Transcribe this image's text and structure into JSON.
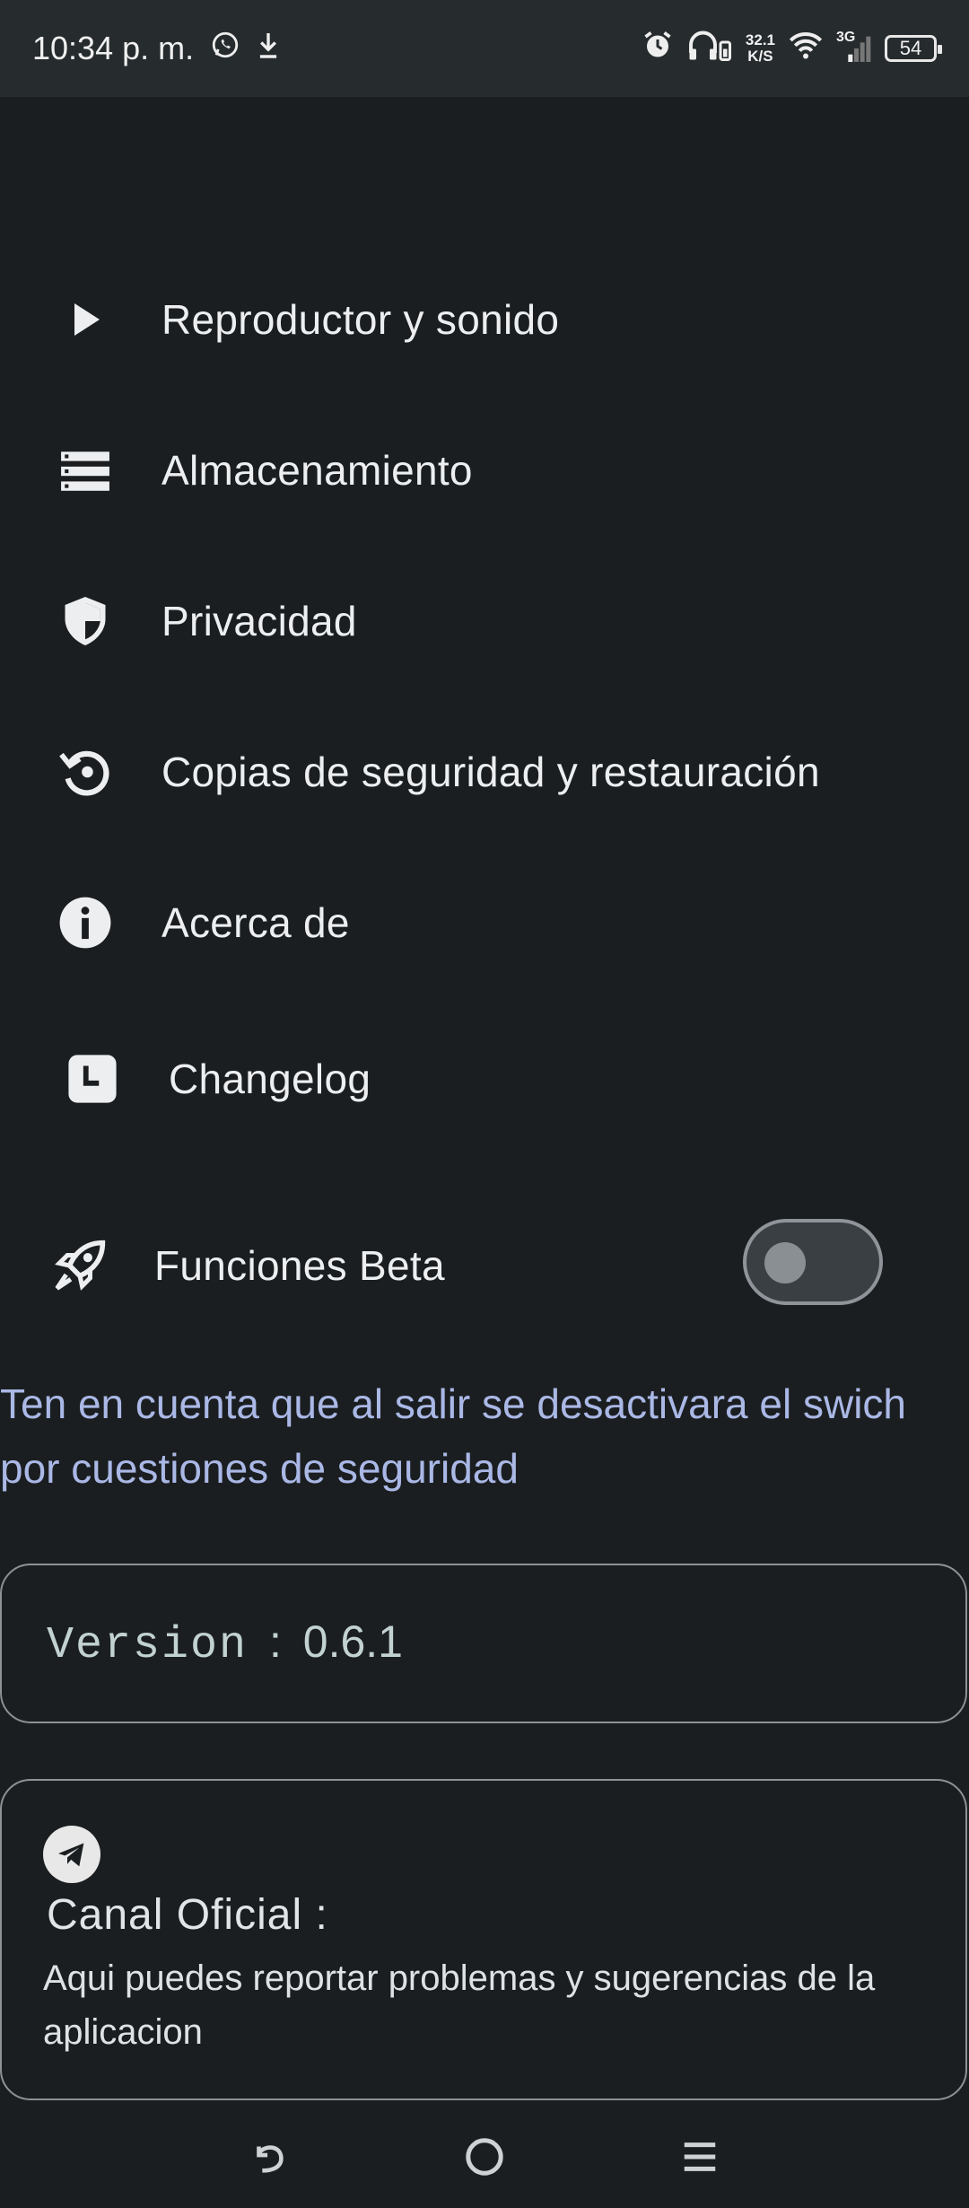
{
  "status_bar": {
    "time": "10:34 p. m.",
    "net_speed_value": "32.1",
    "net_speed_unit": "K/S",
    "network_type": "3G",
    "battery": "54"
  },
  "menu": {
    "items": [
      {
        "label": "Reproductor y sonido",
        "icon": "play-icon"
      },
      {
        "label": "Almacenamiento",
        "icon": "storage-icon"
      },
      {
        "label": "Privacidad",
        "icon": "shield-icon"
      },
      {
        "label": "Copias de seguridad y restauración",
        "icon": "backup-restore-icon"
      },
      {
        "label": "Acerca de",
        "icon": "info-icon"
      },
      {
        "label": "Changelog",
        "icon": "clock-icon"
      }
    ]
  },
  "beta": {
    "label": "Funciones Beta",
    "icon": "rocket-icon",
    "enabled": false
  },
  "note": "Ten en cuenta que al salir se desactivara el swich por cuestiones de seguridad",
  "version": {
    "label": "Version",
    "separator": ":",
    "value": "0.6.1"
  },
  "channel": {
    "icon": "telegram-icon",
    "title": "Canal Oficial :",
    "description": "Aqui puedes reportar problemas y sugerencias de la aplicacion"
  },
  "nav": {
    "back_icon": "back-icon",
    "home_icon": "home-icon",
    "menu_icon": "menu-icon"
  },
  "colors": {
    "background": "#1b1e20",
    "status_bar": "#262b2e",
    "note_text": "#aab8e6",
    "card_border": "#8c9296"
  }
}
